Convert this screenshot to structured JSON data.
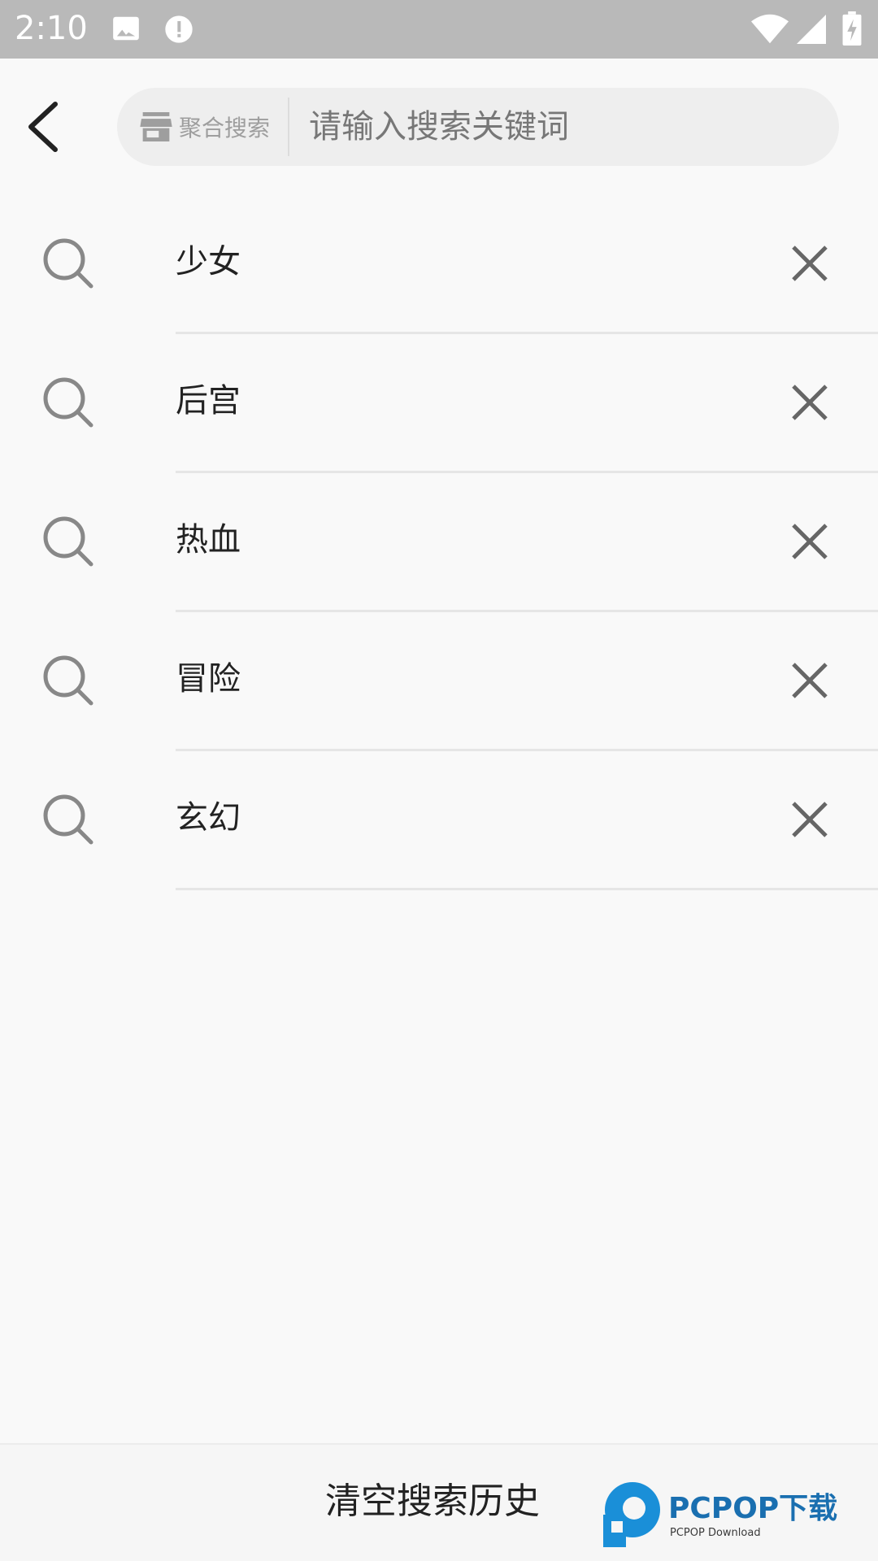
{
  "status_bar": {
    "time": "2:10",
    "icons": [
      "image-icon",
      "alert-icon",
      "wifi-icon",
      "signal-icon",
      "battery-charging-icon"
    ]
  },
  "toolbar": {
    "back_icon": "back-arrow-icon",
    "search_scope_label": "聚合搜索",
    "search_scope_icon": "store-icon",
    "search_placeholder": "请输入搜索关键词",
    "search_value": ""
  },
  "history": {
    "items": [
      {
        "label": "少女"
      },
      {
        "label": "后宫"
      },
      {
        "label": "热血"
      },
      {
        "label": "冒险"
      },
      {
        "label": "玄幻"
      }
    ],
    "item_icon": "search-icon",
    "delete_icon": "close-icon"
  },
  "footer": {
    "clear_label": "清空搜索历史",
    "watermark_text": "PCPOP下载",
    "watermark_subtext": "PCPOP Download"
  },
  "colors": {
    "status_bar": "#b9b9b9",
    "background": "#f9f9f9",
    "search_box": "#eeeeee",
    "icon_gray": "#888888",
    "watermark_blue": "#1a8fd8"
  }
}
